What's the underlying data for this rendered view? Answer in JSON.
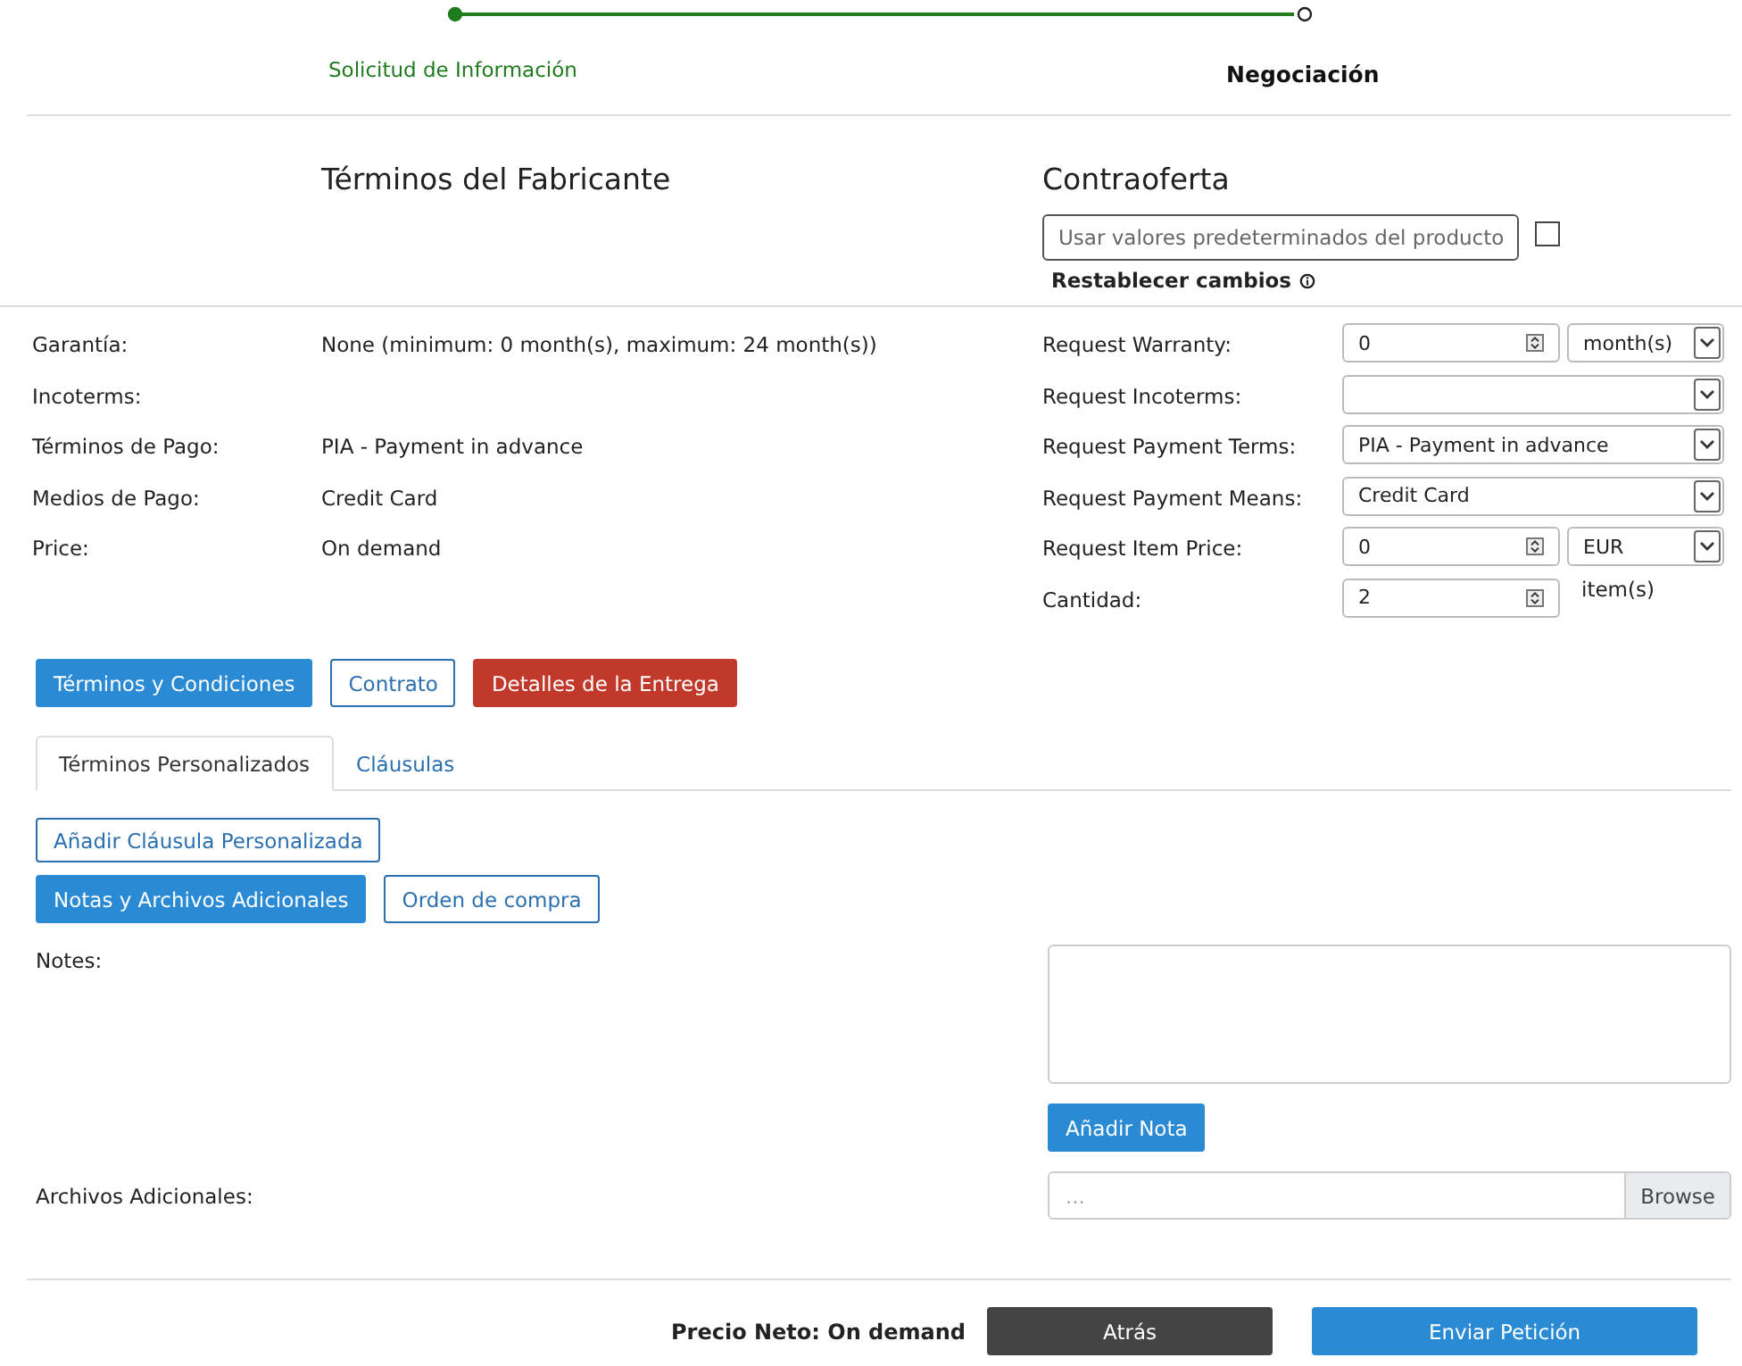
{
  "steps": [
    {
      "label": "Solicitud de Información",
      "done": true
    },
    {
      "label": "Negociación",
      "done": false
    }
  ],
  "manufacturer_terms": {
    "title": "Términos del Fabricante",
    "rows": [
      {
        "label": "Garantía:",
        "value": "None (minimum: 0 month(s), maximum: 24 month(s))"
      },
      {
        "label": "Incoterms:"
      },
      {
        "label": "Términos de Pago:",
        "value": "PIA - Payment in advance"
      },
      {
        "label": "Medios de Pago:",
        "value": "Credit Card"
      },
      {
        "label": "Price:",
        "value": "On demand"
      }
    ]
  },
  "counteroffer": {
    "title": "Contraoferta",
    "defaults_field": {
      "placeholder": "Usar valores predeterminados del producto"
    },
    "defaults_checked": false,
    "reset_link": "Restablecer cambios",
    "rows": [
      {
        "kind": "number_select",
        "label": "Request Warranty:",
        "value": "0",
        "unit": "month(s)"
      },
      {
        "kind": "select",
        "label": "Request Incoterms:"
      },
      {
        "kind": "select",
        "label": "Request Payment Terms:",
        "value": "PIA - Payment in advance"
      },
      {
        "kind": "select",
        "label": "Request Payment Means:",
        "value": "Credit Card"
      },
      {
        "kind": "number_select",
        "label": "Request Item Price:",
        "value": "0",
        "unit": "EUR"
      },
      {
        "kind": "number_text",
        "label": "Cantidad:",
        "value": "2",
        "unit": "item(s)"
      }
    ]
  },
  "action_buttons": [
    {
      "label": "Términos y Condiciones",
      "kind": "primary"
    },
    {
      "label": "Contrato",
      "kind": "outline"
    },
    {
      "label": "Detalles de la Entrega",
      "kind": "danger"
    }
  ],
  "tabs": [
    {
      "label": "Términos Personalizados",
      "selected": true
    },
    {
      "label": "Cláusulas",
      "selected": false
    }
  ],
  "add_clause_button": "Añadir Cláusula Personalizada",
  "sub_buttons": [
    {
      "label": "Notas y Archivos Adicionales",
      "kind": "primary"
    },
    {
      "label": "Orden de compra",
      "kind": "outline"
    }
  ],
  "notes": {
    "label": "Notes:",
    "button": "Añadir Nota"
  },
  "files": {
    "label": "Archivos Adicionales:",
    "placeholder": "...",
    "button": "Browse"
  },
  "footer": {
    "net_price": "Precio Neto: On demand",
    "buttons": [
      {
        "label": "Atrás",
        "kind": "dark"
      },
      {
        "label": "Enviar Petición",
        "kind": "primary"
      }
    ]
  }
}
